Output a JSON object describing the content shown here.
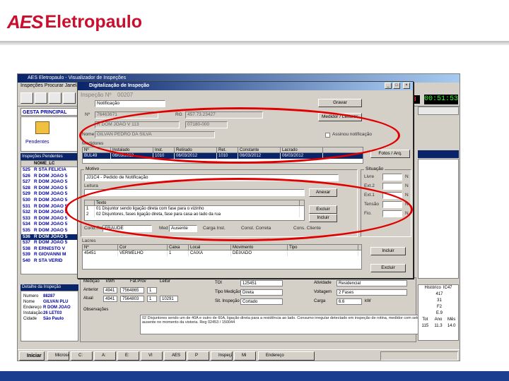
{
  "brand": {
    "mark": "AES",
    "name": "Eletropaulo",
    "color": "#c8102e",
    "footer_color": "#1b3e8f"
  },
  "app": {
    "window_title": "AES Eletropaulo - Visualizador de Inspeções",
    "menu": "Inspeções   Procurar   Janela   Ajuda",
    "gesta_label": "GESTA PRINCIPAL",
    "pendentes_label": "Pendentes",
    "counter": "28",
    "clock": "00:51:53",
    "inspecoes_title": "Inspeções Pendentes",
    "list_header": "NOME_LC",
    "list": [
      {
        "n": "525",
        "name": "R STA FELICIA"
      },
      {
        "n": "526",
        "name": "R DOM JOAO 5"
      },
      {
        "n": "527",
        "name": "R DOM JOAO 5"
      },
      {
        "n": "528",
        "name": "R DOM JOAO 5"
      },
      {
        "n": "529",
        "name": "R DOM JOAO 5"
      },
      {
        "n": "530",
        "name": "R DOM JOAO 5"
      },
      {
        "n": "531",
        "name": "R DOM JOAO 5"
      },
      {
        "n": "532",
        "name": "R DOM JOAO 5"
      },
      {
        "n": "533",
        "name": "R DOM JOAO 5"
      },
      {
        "n": "534",
        "name": "R DOM JOAO 5"
      },
      {
        "n": "535",
        "name": "R DOM JOAO 5"
      },
      {
        "n": "536",
        "name": "R DOM JOAO 5"
      },
      {
        "n": "537",
        "name": "R DOM JOAO 5"
      },
      {
        "n": "538",
        "name": "R ERNESTO V"
      },
      {
        "n": "539",
        "name": "R GIOVANNI M"
      },
      {
        "n": "540",
        "name": "R STA VERID"
      }
    ],
    "selected_index": 11,
    "detalhe_title": "Detalhe da Inspeção",
    "detalhe": [
      {
        "k": "Numero",
        "v": "88287"
      },
      {
        "k": "Nome",
        "v": "GILVAN PLU"
      },
      {
        "k": "Endereço",
        "v": "R DOM JOAO"
      },
      {
        "k": "Instalação",
        "v": "26 LET03"
      },
      {
        "k": "Cidade",
        "v": "São Paulo"
      }
    ],
    "lower": {
      "medicao_label": "Medição",
      "kwh_label": "kWh",
      "fat_label": "Fat.Prov",
      "leit_label": "Leitur",
      "anterior_label": "Anterior",
      "anterior_vals": [
        "4941",
        "7564865",
        "1",
        ""
      ],
      "atual_label": "Atual",
      "atual_vals": [
        "4941",
        "7564803",
        "1",
        "10291"
      ],
      "tol_label": "TOI",
      "tol_value": "125451",
      "tipo_med_label": "Tipo Medição",
      "tipo_med_value": "Direta",
      "situacao_label": "Sit. Inspeção",
      "situacao_value": "Cortado",
      "ativ_label": "Atividade",
      "ativ_value": "Residencial",
      "voltagem_label": "Voltagem",
      "voltagem_value": "2 Fases",
      "carga_label": "Carga",
      "carga_value": "6.6",
      "carga_unit": "kW",
      "obs_label": "Observações",
      "obs_text": "02 Disjuntores sendo um de 40A e outro de 60A, ligação direta para a residência ao lado. Consumo irregular detectado em inspeção de rotina, medidor com selo violado e cliente ausente no momento da vistoria. Reg 02453 / 150044"
    },
    "rt_table": [
      {
        "l": "Histórico",
        "v": "IC47"
      },
      {
        "l": "",
        "v": "417"
      },
      {
        "l": "",
        "v": "31"
      },
      {
        "l": "",
        "v": "F2"
      },
      {
        "l": "",
        "v": "E.9"
      }
    ],
    "rt_table_bottom": {
      "h": [
        "Tot",
        "Ano",
        "Mês"
      ],
      "v": [
        "115",
        "11.3",
        "14.0"
      ]
    },
    "taskbar": {
      "start": "Iniciar",
      "items": [
        "Microsoft",
        "C:",
        "A:",
        "E:",
        "VI",
        "AES",
        "P",
        "Inspeção",
        "Mi"
      ],
      "search_label": "Endereço"
    }
  },
  "dialog": {
    "title": "Digitalização de Inspeção",
    "inspecao_label": "Inspeção Nº",
    "inspecao_value": "00207",
    "tipo_value": "Notificação",
    "btn_gravar": "Gravar",
    "btn_medidor": "Medidor / Leituras",
    "nc_label": "Nº",
    "nc_value": "76463671",
    "rg_label": "RG",
    "rg_value": "457.73.23427",
    "endereco_value": "R DOM JOAO V 113",
    "cep_value": "07180-000",
    "nome_label": "Nome",
    "nome_value": "GILVAN PEDRO DA SILVA",
    "check_label": "Assinou notificação",
    "medidores_title": "Medidores",
    "medidores_cols": [
      "Nº",
      "Instalado",
      "Inst.",
      "Retirado",
      "Ret.",
      "Constante",
      "Lacrado"
    ],
    "medidores_row": [
      "BUL49",
      "06/03/2012",
      "1010",
      "06/03/2012",
      "1010",
      "06/03/2012",
      "06/03/2012"
    ],
    "btn_fotos": "Fotos / Arq.",
    "motivo_label": "Motivo",
    "motivo_value": "JJ1C4 - Pedido de Notificação",
    "leitura_label": "Leitura",
    "btn_anexar": "Anexar",
    "grid2_cols": [
      "",
      "Texto"
    ],
    "grid2_rows": [
      {
        "n": "1",
        "t": "01 Disjuntor sendo ligação direta com fase para o vizinho"
      },
      {
        "n": "2",
        "t": "02 Disjuntores, fases ligação direta, fase para casa ao lado da rua"
      }
    ],
    "btn_excluir": "Excluir",
    "btn_incluir": "Incluir",
    "sit_label": "Situação",
    "sit_items": [
      "Livre",
      "Ext.2",
      "Ext.1",
      "Tensão",
      "Fio."
    ],
    "sit_values": [
      "",
      "",
      "",
      "",
      ""
    ],
    "sit_side": [
      "N",
      "N",
      "N",
      "N",
      "N"
    ],
    "cond_label": "Cond.Ref",
    "cond_value": "FRAUDE",
    "med_label": "Med",
    "med_value": "Ausente",
    "carga_inst_label": "Carga Inst.",
    "const_label": "Const. Correta",
    "cons_label": "Cons. Cliente",
    "lacre_title": "Lacres",
    "lacre_cols": [
      "Nº",
      "Cor",
      "Caixa",
      "Local",
      "Movimento",
      "Tipo"
    ],
    "lacre_row": [
      "45451",
      "VERMELHO",
      "1",
      "CAIXA",
      "DEIXADO",
      ""
    ],
    "btn_incluir2": "Incluir",
    "btn_excluir2": "Excluir"
  }
}
